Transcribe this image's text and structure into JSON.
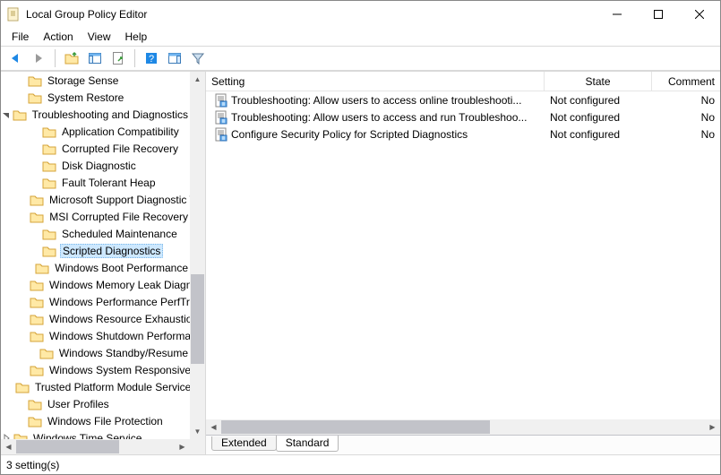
{
  "window": {
    "title": "Local Group Policy Editor"
  },
  "menu": {
    "file": "File",
    "action": "Action",
    "view": "View",
    "help": "Help"
  },
  "tree": {
    "items": [
      {
        "indent": 1,
        "toggle": "",
        "label": "Storage Sense",
        "icon": "folder"
      },
      {
        "indent": 1,
        "toggle": "",
        "label": "System Restore",
        "icon": "folder"
      },
      {
        "indent": 0,
        "toggle": "open",
        "label": "Troubleshooting and Diagnostics",
        "icon": "folder"
      },
      {
        "indent": 2,
        "toggle": "",
        "label": "Application Compatibility",
        "icon": "folder"
      },
      {
        "indent": 2,
        "toggle": "",
        "label": "Corrupted File Recovery",
        "icon": "folder"
      },
      {
        "indent": 2,
        "toggle": "",
        "label": "Disk Diagnostic",
        "icon": "folder"
      },
      {
        "indent": 2,
        "toggle": "",
        "label": "Fault Tolerant Heap",
        "icon": "folder"
      },
      {
        "indent": 2,
        "toggle": "",
        "label": "Microsoft Support Diagnostic Tool",
        "icon": "folder"
      },
      {
        "indent": 2,
        "toggle": "",
        "label": "MSI Corrupted File Recovery",
        "icon": "folder"
      },
      {
        "indent": 2,
        "toggle": "",
        "label": "Scheduled Maintenance",
        "icon": "folder"
      },
      {
        "indent": 2,
        "toggle": "",
        "label": "Scripted Diagnostics",
        "icon": "folder",
        "selected": true
      },
      {
        "indent": 2,
        "toggle": "",
        "label": "Windows Boot Performance",
        "icon": "folder"
      },
      {
        "indent": 2,
        "toggle": "",
        "label": "Windows Memory Leak Diagnosis",
        "icon": "folder"
      },
      {
        "indent": 2,
        "toggle": "",
        "label": "Windows Performance PerfTrack",
        "icon": "folder"
      },
      {
        "indent": 2,
        "toggle": "",
        "label": "Windows Resource Exhaustion",
        "icon": "folder"
      },
      {
        "indent": 2,
        "toggle": "",
        "label": "Windows Shutdown Performance",
        "icon": "folder"
      },
      {
        "indent": 2,
        "toggle": "",
        "label": "Windows Standby/Resume",
        "icon": "folder"
      },
      {
        "indent": 2,
        "toggle": "",
        "label": "Windows System Responsiveness",
        "icon": "folder"
      },
      {
        "indent": 1,
        "toggle": "",
        "label": "Trusted Platform Module Services",
        "icon": "folder"
      },
      {
        "indent": 1,
        "toggle": "",
        "label": "User Profiles",
        "icon": "folder"
      },
      {
        "indent": 1,
        "toggle": "",
        "label": "Windows File Protection",
        "icon": "folder"
      },
      {
        "indent": 0,
        "toggle": "closed",
        "label": "Windows Time Service",
        "icon": "folder"
      }
    ]
  },
  "list": {
    "columns": {
      "setting": "Setting",
      "state": "State",
      "comment": "Comment"
    },
    "rows": [
      {
        "setting": "Troubleshooting: Allow users to access online troubleshooti...",
        "state": "Not configured",
        "comment": "No"
      },
      {
        "setting": "Troubleshooting: Allow users to access and run Troubleshoo...",
        "state": "Not configured",
        "comment": "No"
      },
      {
        "setting": "Configure Security Policy for Scripted Diagnostics",
        "state": "Not configured",
        "comment": "No"
      }
    ]
  },
  "tabs": {
    "extended": "Extended",
    "standard": "Standard"
  },
  "status": {
    "text": "3 setting(s)"
  }
}
